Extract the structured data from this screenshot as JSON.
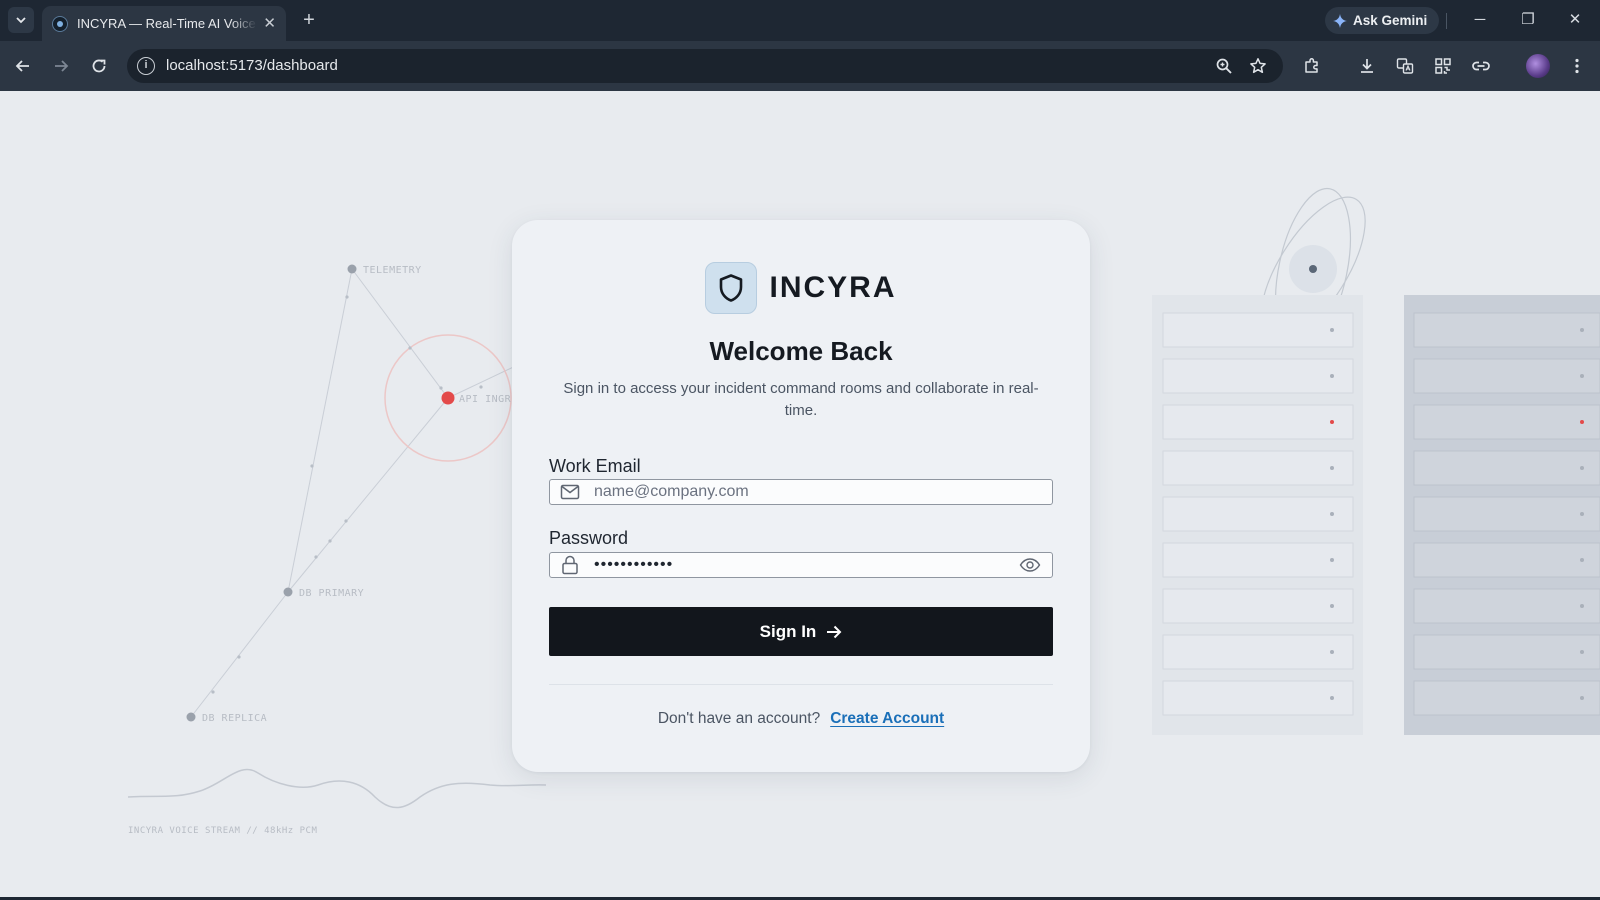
{
  "browser": {
    "tab": {
      "title": "INCYRA — Real-Time AI Voice Incident Command",
      "close": "✕"
    },
    "new_tab": "+",
    "gemini_label": "Ask Gemini",
    "window": {
      "minimize": "─",
      "restore": "❐",
      "close": "✕"
    },
    "url": "localhost:5173/dashboard",
    "info": "i"
  },
  "background": {
    "nodes": {
      "telemetry": "TELEMETRY",
      "api": "API INGR",
      "db_primary": "DB PRIMARY",
      "db_replica": "DB REPLICA"
    },
    "stream_caption": "INCYRA VOICE STREAM // 48kHz PCM",
    "accent_color": "#e34a4a"
  },
  "login": {
    "brand": "INCYRA",
    "heading": "Welcome Back",
    "subtitle": "Sign in to access your incident command rooms and collaborate in real-time.",
    "email": {
      "label": "Work Email",
      "placeholder": "name@company.com",
      "value": ""
    },
    "password": {
      "label": "Password",
      "value": "••••••••••••"
    },
    "submit_label": "Sign In",
    "footer": {
      "question": "Don't have an account?",
      "link": "Create Account"
    }
  }
}
